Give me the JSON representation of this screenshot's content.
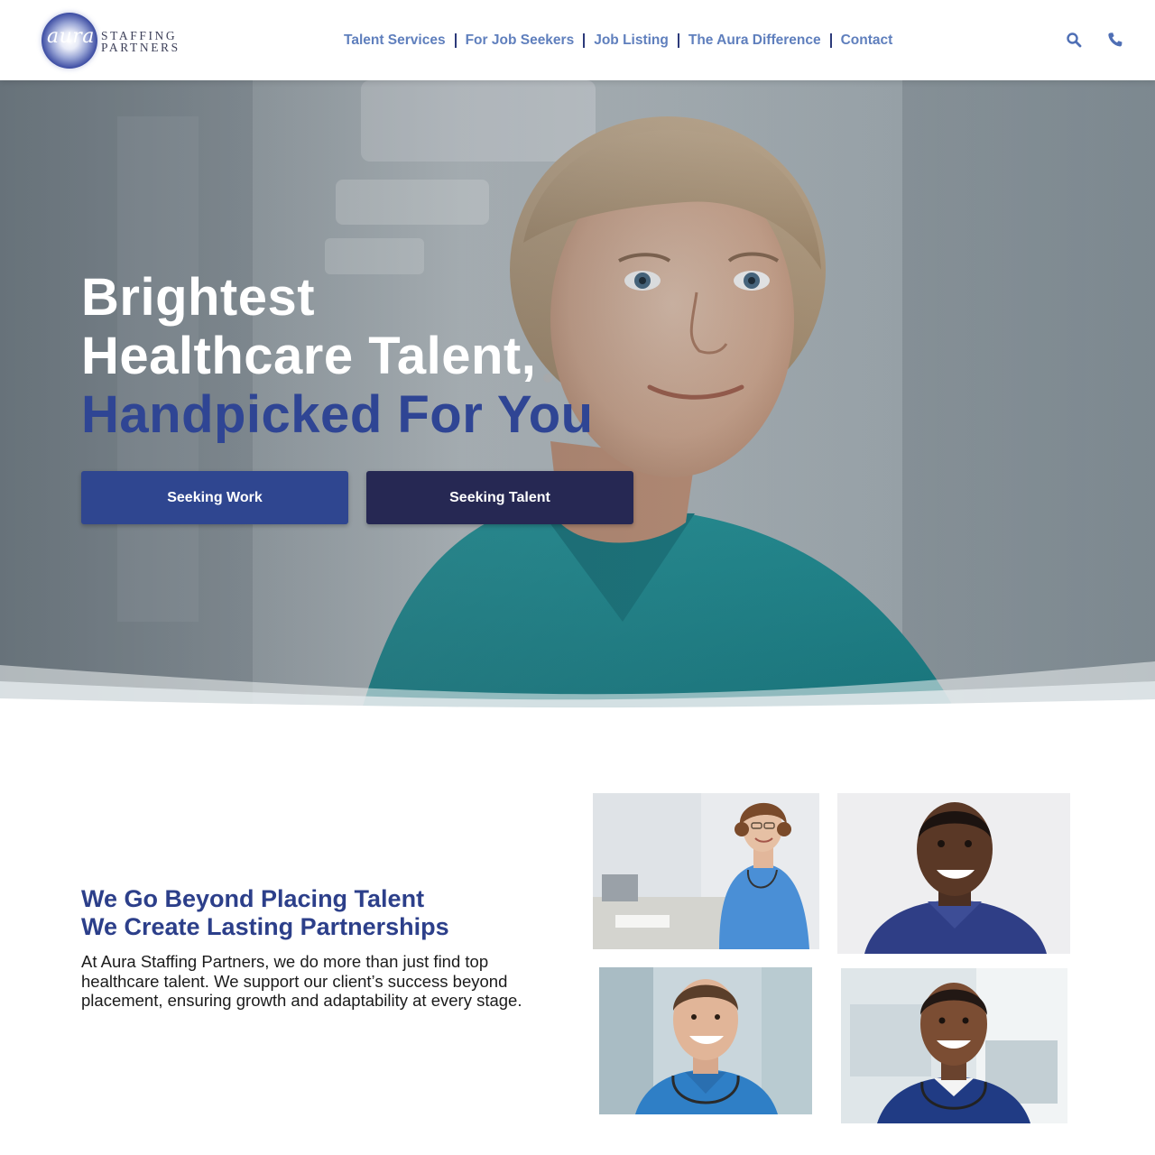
{
  "brand": {
    "logo_script": "aura",
    "logo_line1": "STAFFING",
    "logo_line2": "PARTNERS",
    "accent_color": "#2f4594",
    "nav_color": "#5f7fbd"
  },
  "nav": {
    "items": [
      {
        "label": "Talent Services"
      },
      {
        "label": "For Job Seekers"
      },
      {
        "label": "Job Listing"
      },
      {
        "label": "The Aura Difference"
      },
      {
        "label": "Contact"
      }
    ],
    "icons": [
      "search-icon",
      "phone-icon"
    ]
  },
  "hero": {
    "title_line1": "Brightest",
    "title_line2": "Healthcare Talent,",
    "title_line3": "Handpicked For You",
    "cta_primary": "Seeking Work",
    "cta_secondary": "Seeking Talent"
  },
  "partnerships": {
    "heading_line1": "We Go Beyond Placing Talent",
    "heading_line2": "We Create Lasting Partnerships",
    "body": "At Aura Staffing Partners, we do more than just find top healthcare talent. We support our client’s success beyond placement, ensuring growth and adaptability at every stage."
  }
}
